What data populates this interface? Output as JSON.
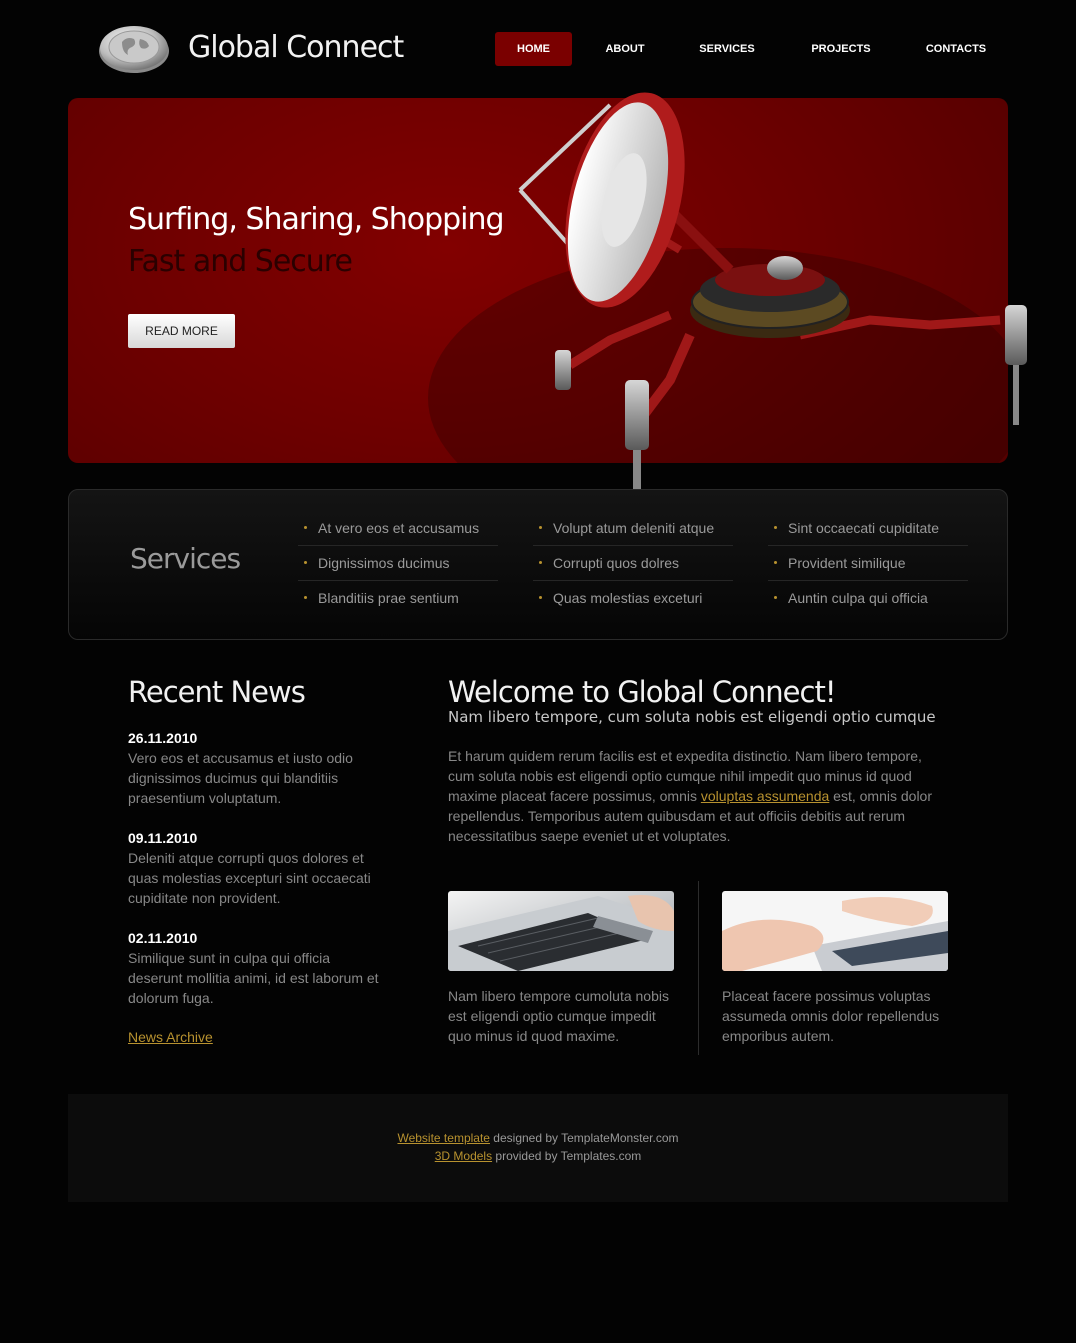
{
  "brand": {
    "name": "Global Connect",
    "logo_icon": "globe-icon"
  },
  "nav": {
    "items": [
      "HOME",
      "ABOUT",
      "SERVICES",
      "PROJECTS",
      "CONTACTS"
    ],
    "active": "HOME"
  },
  "banner": {
    "headline": "Surfing, Sharing, Shopping",
    "subheadline": "Fast and Secure",
    "button_label": "READ MORE",
    "illustration": "satellite-robot-icon"
  },
  "services": {
    "title": "Services",
    "columns": [
      [
        "At vero eos et accusamus",
        "Dignissimos ducimus",
        "Blanditiis prae sentium"
      ],
      [
        "Volupt atum deleniti atque",
        "Corrupti quos dolres",
        "Quas molestias exceturi"
      ],
      [
        "Sint occaecati cupiditate",
        "Provident similique",
        "Auntin culpa qui officia"
      ]
    ]
  },
  "news": {
    "title": "Recent News",
    "items": [
      {
        "date": "26.11.2010",
        "text": "Vero eos et accusamus et iusto odio dignissimos ducimus qui blanditiis praesentium voluptatum."
      },
      {
        "date": "09.11.2010",
        "text": "Deleniti atque corrupti quos dolores et quas molestias excepturi sint occaecati cupiditate non provident."
      },
      {
        "date": "02.11.2010",
        "text": "Similique sunt in culpa qui officia deserunt mollitia animi, id est laborum et dolorum fuga."
      }
    ],
    "archive_link": "News Archive"
  },
  "welcome": {
    "title": "Welcome to Global Connect!",
    "subtitle": "Nam libero tempore, cum soluta nobis est eligendi optio cumque",
    "body_before": "Et harum quidem rerum facilis est et expedita distinctio. Nam libero tempore, cum soluta nobis est eligendi optio cumque nihil impedit quo minus id quod maxime placeat facere possimus, omnis ",
    "body_link": "voluptas assumenda",
    "body_after": " est, omnis dolor repellendus. Temporibus autem quibusdam et aut officiis debitis aut rerum necessitatibus saepe eveniet ut et voluptates.",
    "features": [
      {
        "image": "laptop-keyboard-card-photo",
        "caption": "Nam libero tempore cumoluta nobis est eligendi optio cumque impedit quo minus id quod maxime."
      },
      {
        "image": "hands-typing-photo",
        "caption": "Placeat facere possimus voluptas assumeda omnis dolor repellendus emporibus autem."
      }
    ]
  },
  "footer": {
    "line1_link": "Website template",
    "line1_text": " designed by TemplateMonster.com",
    "line2_link": "3D Models",
    "line2_text": " provided by Templates.com"
  },
  "colors": {
    "accent_red": "#7a0000",
    "link_gold": "#b8922f",
    "background": "#030303"
  }
}
